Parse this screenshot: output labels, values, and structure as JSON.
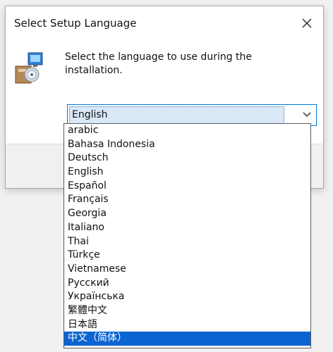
{
  "dialog": {
    "title": "Select Setup Language",
    "close_icon": "close-icon",
    "setup_icon": "setup-installer-icon",
    "message": "Select the language to use during the installation."
  },
  "language_select": {
    "value": "English",
    "chevron_icon": "chevron-down-icon"
  },
  "language_list": {
    "options": [
      "arabic",
      "Bahasa Indonesia",
      "Deutsch",
      "English",
      "Español",
      "Français",
      "Georgia",
      "Italiano",
      "Thai",
      "Türkçe",
      "Vietnamese",
      "Русский",
      "Українська",
      "繁體中文",
      "日本語",
      "中文（简体）"
    ],
    "highlighted_index": 15
  },
  "colors": {
    "accent": "#0078d7",
    "highlight": "#0a64d2",
    "selected_field_bg": "#d9e8f7"
  }
}
